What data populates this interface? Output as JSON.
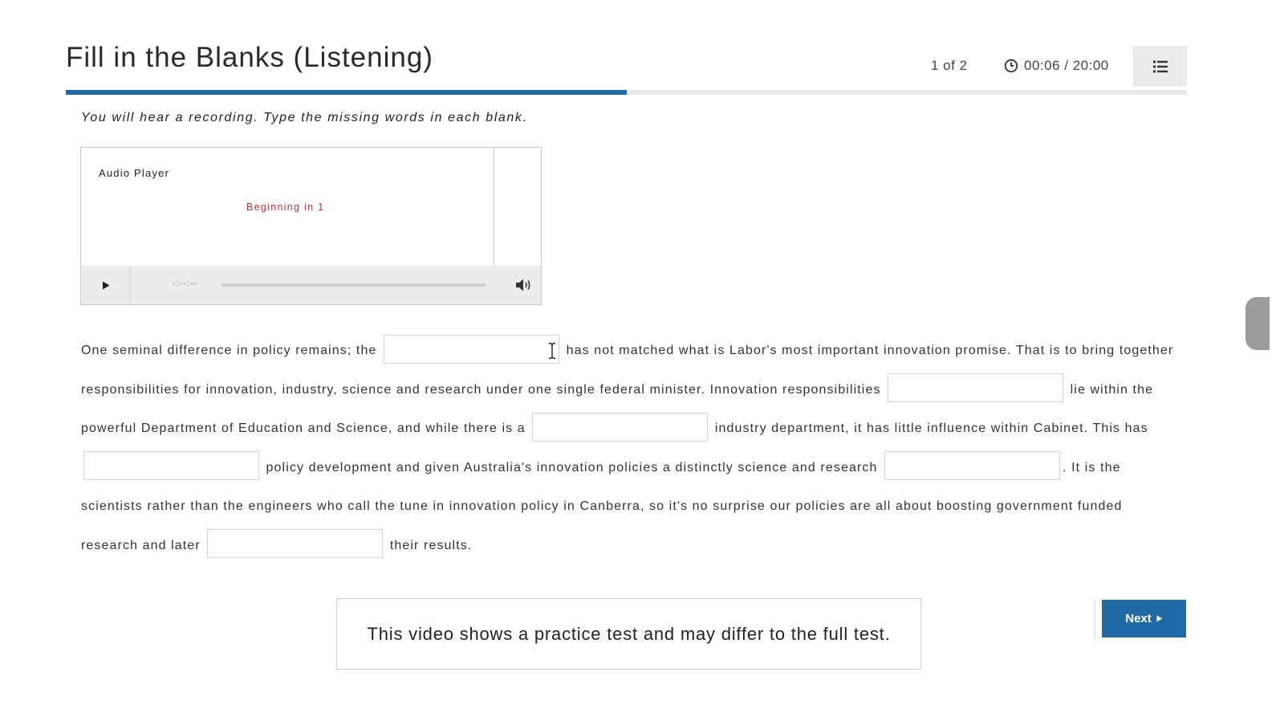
{
  "header": {
    "title": "Fill in the Blanks (Listening)",
    "counter": "1 of 2",
    "timer": "00:06 / 20:00",
    "progress": 0.5,
    "menu_icon": "list-icon"
  },
  "instruction": "You will hear a recording. Type the missing words in each blank.",
  "audio_player": {
    "label": "Audio Player",
    "status": "Beginning in 1",
    "time": "-:--:--",
    "status_color": "#b0353b"
  },
  "passage": {
    "segments": [
      "One seminal difference in policy remains; the",
      "has not matched what is Labor's most important innovation promise. That is to bring together responsibilities for innovation, industry, science and research under one single federal minister. Innovation responsibilities",
      "lie within the powerful Department of Education and Science, and while there is a",
      "industry department, it has little influence within Cabinet. This has",
      "policy development and given Australia's innovation policies a distinctly science and research",
      ". It is the scientists rather than the engineers who call the tune in innovation policy in Canberra, so it's no surprise our policies are all about boosting government funded research and later",
      "their results."
    ],
    "blanks": [
      "",
      "",
      "",
      "",
      "",
      ""
    ]
  },
  "notice": "This video shows a practice test and may differ to the full test.",
  "footer": {
    "next_label": "Next"
  },
  "colors": {
    "accent": "#1f6aa5"
  }
}
